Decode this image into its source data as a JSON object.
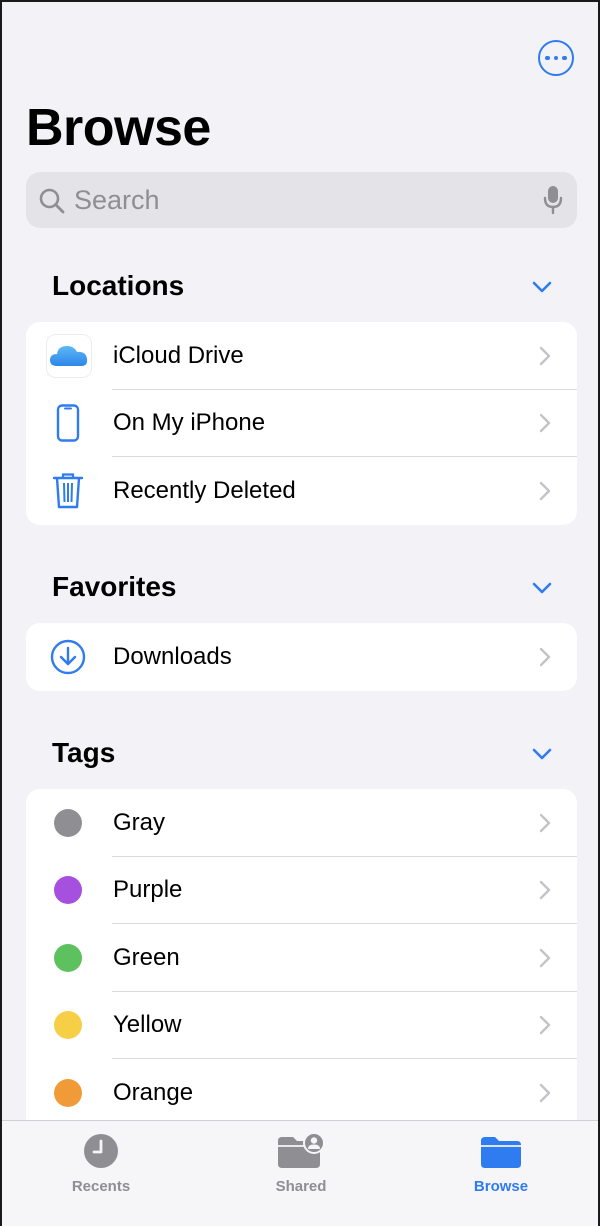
{
  "header": {
    "title": "Browse",
    "more_icon": "ellipsis-circle-icon"
  },
  "search": {
    "placeholder": "Search"
  },
  "locations": {
    "title": "Locations",
    "items": [
      {
        "label": "iCloud Drive",
        "icon": "icloud-icon"
      },
      {
        "label": "On My iPhone",
        "icon": "iphone-icon"
      },
      {
        "label": "Recently Deleted",
        "icon": "trash-icon"
      }
    ]
  },
  "favorites": {
    "title": "Favorites",
    "items": [
      {
        "label": "Downloads",
        "icon": "download-circle-icon"
      }
    ]
  },
  "tags": {
    "title": "Tags",
    "items": [
      {
        "label": "Gray",
        "color": "#8e8e93"
      },
      {
        "label": "Purple",
        "color": "#a550de"
      },
      {
        "label": "Green",
        "color": "#5ec15f"
      },
      {
        "label": "Yellow",
        "color": "#f7cf46"
      },
      {
        "label": "Orange",
        "color": "#f19a38"
      }
    ]
  },
  "tabbar": {
    "tabs": [
      {
        "label": "Recents",
        "icon": "clock-icon",
        "active": false
      },
      {
        "label": "Shared",
        "icon": "shared-folder-icon",
        "active": false
      },
      {
        "label": "Browse",
        "icon": "folder-icon",
        "active": true
      }
    ]
  },
  "colors": {
    "accent": "#2f7bf0",
    "background": "#f2f2f7"
  }
}
